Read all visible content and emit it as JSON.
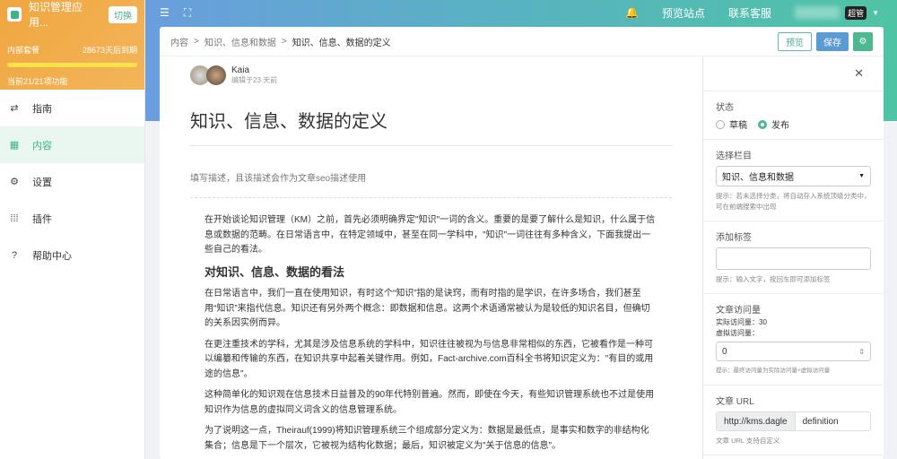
{
  "app": {
    "name": "知识管理应用...",
    "switch_label": "切换",
    "plan_label": "内部套餐",
    "plan_expiry": "28673天后到期",
    "plan_progress": 1.0,
    "features": "当前21/21项功能"
  },
  "topnav": {
    "preview_site": "预览站点",
    "contact": "联系客服",
    "role_badge": "超管"
  },
  "sidebar": {
    "items": [
      {
        "label": "指南",
        "icon": "guide-icon"
      },
      {
        "label": "内容",
        "icon": "grid-icon",
        "active": true
      },
      {
        "label": "设置",
        "icon": "gear-icon"
      },
      {
        "label": "插件",
        "icon": "apps-icon"
      },
      {
        "label": "帮助中心",
        "icon": "help-icon"
      }
    ]
  },
  "breadcrumb": {
    "items": [
      "内容",
      "知识、信息和数据",
      "知识、信息、数据的定义"
    ],
    "sep": ">"
  },
  "toolbar": {
    "preview": "预览",
    "save": "保存"
  },
  "article": {
    "author": "Kaia",
    "edited": "编辑于23 天前",
    "title": "知识、信息、数据的定义",
    "description_placeholder": "填写描述，且该描述会作为文章seo描述使用",
    "p1": "在开始谈论知识管理（KM）之前，首先必须明确界定\"知识\"一词的含义。重要的是要了解什么是知识，什么属于信息或数据的范畴。在日常语言中，在特定领域中，甚至在同一学科中，\"知识\"一词往往有多种含义，下面我提出一些自己的看法。",
    "h2": "对知识、信息、数据的看法",
    "p2": "在日常语言中，我们一直在使用知识，有时这个“知识”指的是诀窍，而有时指的是学识，在许多场合，我们甚至用“知识”来指代信息。知识还有另外两个概念：即数据和信息。这两个术语通常被认为是较低的知识名目，但确切的关系因实例而异。",
    "p3": "在更注重技术的学科，尤其是涉及信息系统的学科中，知识往往被视为与信息非常相似的东西，它被看作是一种可以编纂和传输的东西，在知识共享中起着关键作用。例如，Fact-archive.com百科全书将知识定义为：\"有目的或用途的信息\"。",
    "p4": "这种简单化的知识观在信息技术日益普及的90年代特别普遍。然而，即使在今天，有些知识管理系统也不过是使用知识作为信息的虚拟同义词含义的信息管理系统。",
    "p5": "为了说明这一点，Theirauf(1999)将知识管理系统三个组成部分定义为：数据是最低点，是事实和数字的非结构化集合；信息是下一个层次，它被视为结构化数据；最后，知识被定义为\"关于信息的信息\"。"
  },
  "panel": {
    "status_label": "状态",
    "draft": "草稿",
    "publish": "发布",
    "category_label": "选择栏目",
    "category_value": "知识、信息和数据",
    "category_hint": "提示：若未选择分类，将自动存入系统顶级分类中，可在前端搜索中出现",
    "tags_label": "添加标签",
    "tags_hint": "提示：输入文字，按回车即可添加标签",
    "views_label": "文章访问量",
    "actual_views": "实际访问量：30",
    "virtual_views": "虚拟访问量：",
    "virtual_value": "0",
    "views_hint": "提示：最终访问量为实际访问量+虚拟访问量",
    "url_label": "文章 URL",
    "url_prefix": "http://kms.dagle",
    "url_slug": "definition",
    "url_hint": "文章 URL 支持自定义"
  }
}
